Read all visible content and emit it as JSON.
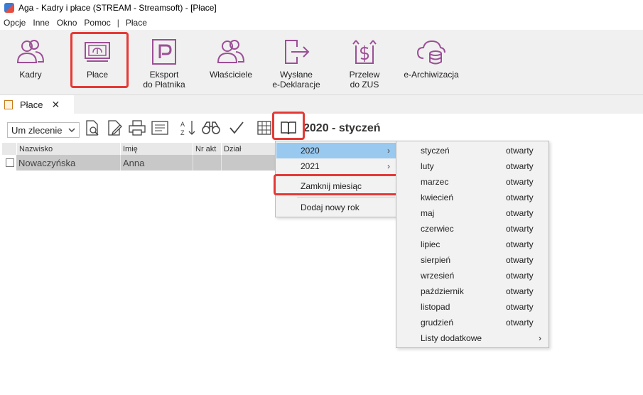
{
  "window": {
    "title": "Aga - Kadry i płace (STREAM - Streamsoft) - [Płace]"
  },
  "menubar": {
    "items": [
      "Opcje",
      "Inne",
      "Okno",
      "Pomoc",
      "|",
      "Płace"
    ]
  },
  "ribbon": {
    "kadry": "Kadry",
    "place": "Płace",
    "eksport_line1": "Eksport",
    "eksport_line2": "do Płatnika",
    "wlasciciele": "Właściciele",
    "wyslane_line1": "Wysłane",
    "wyslane_line2": "e-Deklaracje",
    "przelew_line1": "Przelew",
    "przelew_line2": "do ZUS",
    "earchiwizacja": "e-Archiwizacja"
  },
  "tab": {
    "label": "Płace",
    "close": "✕"
  },
  "toolbar": {
    "filter_value": "Um zlecenie",
    "period": "2020 - styczeń"
  },
  "grid": {
    "columns": [
      "Nazwisko",
      "Imię",
      "Nr akt",
      "Dział"
    ],
    "rows": [
      {
        "nazwisko": "Nowaczyńska",
        "imie": "Anna",
        "nr_akt": "",
        "dzial": ""
      }
    ]
  },
  "menu1": {
    "items": [
      "2020",
      "2021",
      "Zamknij miesiąc",
      "Dodaj nowy rok"
    ],
    "arrow": "›"
  },
  "menu2": {
    "months": [
      {
        "name": "styczeń",
        "status": "otwarty"
      },
      {
        "name": "luty",
        "status": "otwarty"
      },
      {
        "name": "marzec",
        "status": "otwarty"
      },
      {
        "name": "kwiecień",
        "status": "otwarty"
      },
      {
        "name": "maj",
        "status": "otwarty"
      },
      {
        "name": "czerwiec",
        "status": "otwarty"
      },
      {
        "name": "lipiec",
        "status": "otwarty"
      },
      {
        "name": "sierpień",
        "status": "otwarty"
      },
      {
        "name": "wrzesień",
        "status": "otwarty"
      },
      {
        "name": "październik",
        "status": "otwarty"
      },
      {
        "name": "listopad",
        "status": "otwarty"
      },
      {
        "name": "grudzień",
        "status": "otwarty"
      }
    ],
    "extra": "Listy dodatkowe"
  },
  "colors": {
    "accent": "#9c4f96",
    "highlight": "#e53935",
    "menu_selected": "#99c9ef"
  }
}
